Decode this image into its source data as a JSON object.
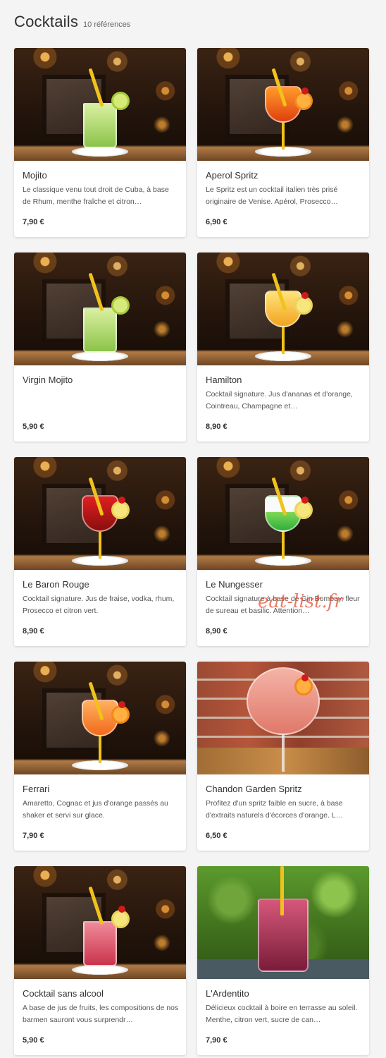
{
  "header": {
    "title": "Cocktails",
    "count": "10 références"
  },
  "items": [
    {
      "name": "Mojito",
      "desc": "Le classique venu tout droit de Cuba, à base de Rhum, menthe fraîche et citron…",
      "price": "7,90 €",
      "scene": "bar",
      "drink": "mojito"
    },
    {
      "name": "Aperol Spritz",
      "desc": "Le Spritz est un cocktail italien très prisé originaire de Venise. Apérol, Prosecco…",
      "price": "6,90 €",
      "scene": "bar",
      "drink": "spritz"
    },
    {
      "name": "Virgin Mojito",
      "desc": "",
      "price": "5,90 €",
      "scene": "bar",
      "drink": "mojito"
    },
    {
      "name": "Hamilton",
      "desc": "Cocktail signature. Jus d'ananas et d'orange, Cointreau, Champagne et…",
      "price": "8,90 €",
      "scene": "bar",
      "drink": "hamilton"
    },
    {
      "name": "Le Baron Rouge",
      "desc": "Cocktail signature. Jus de fraise, vodka, rhum, Prosecco et citron vert.",
      "price": "8,90 €",
      "scene": "bar",
      "drink": "baron"
    },
    {
      "name": "Le Nungesser",
      "desc": "Cocktail signature à base de Gin Bombay, fleur de sureau et basilic. Attention…",
      "price": "8,90 €",
      "scene": "bar",
      "drink": "nungesser"
    },
    {
      "name": "Ferrari",
      "desc": "Amaretto, Cognac et jus d'orange passés au shaker et servi sur glace.",
      "price": "7,90 €",
      "scene": "bar",
      "drink": "ferrari"
    },
    {
      "name": "Chandon Garden Spritz",
      "desc": "Profitez d'un spritz faible en sucre, à base d'extraits naturels d'écorces d'orange. L…",
      "price": "6,50 €",
      "scene": "brick",
      "drink": "chandon"
    },
    {
      "name": "Cocktail sans alcool",
      "desc": "A base de jus de fruits, les compositions de nos barmen sauront vous surprendr…",
      "price": "5,90 €",
      "scene": "bar",
      "drink": "sansalcool"
    },
    {
      "name": "L'Ardentito",
      "desc": "Délicieux cocktail à boire en terrasse au soleil. Menthe, citron vert, sucre de can…",
      "price": "7,90 €",
      "scene": "garden",
      "drink": "ardentito"
    }
  ],
  "watermark": "eat-list.fr"
}
